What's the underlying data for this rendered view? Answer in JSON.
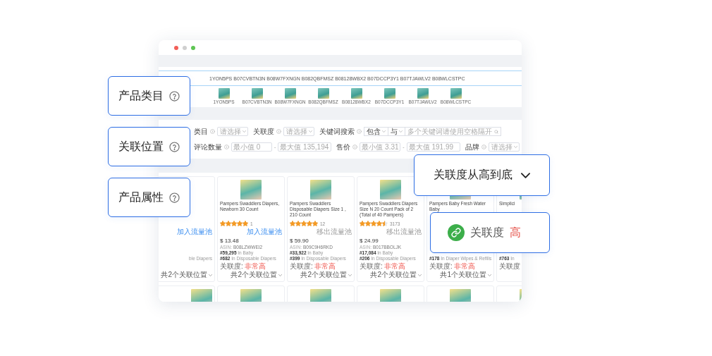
{
  "asin_list": "1YON5PS B07CVBTN3N B08W7FXNGN B082QBFMSZ B08128WBX2 B07DCCP3Y1 B07TJAWLV2 B08WLCSTPC",
  "thumbnails": [
    {
      "asin": "1YON5PS"
    },
    {
      "asin": "B07CVBTN3N"
    },
    {
      "asin": "B08W7FXNGN"
    },
    {
      "asin": "B082QBFMSZ"
    },
    {
      "asin": "B08128WBX2"
    },
    {
      "asin": "B07DCCP3Y1"
    },
    {
      "asin": "B07TJAWLV2"
    },
    {
      "asin": "B08WLCSTPC"
    }
  ],
  "filters": [
    [
      {
        "kind": "select",
        "label": "类目",
        "placeholder": "请选择"
      },
      {
        "kind": "select",
        "label": "关联度",
        "placeholder": "请选择"
      },
      {
        "kind": "keyword",
        "label": "关键词搜索",
        "mode": "包含",
        "logic": "与",
        "placeholder": "多个关键词请使用空格隔开"
      }
    ],
    [
      {
        "kind": "range",
        "label": "评论数量",
        "min_placeholder": "最小值 0",
        "separator": "-",
        "max_placeholder": "最大值 135,194"
      },
      {
        "kind": "range",
        "label": "售价",
        "min_placeholder": "最小值 3.31",
        "separator": "-",
        "max_placeholder": "最大值 191.99"
      },
      {
        "kind": "select",
        "label": "品牌",
        "placeholder": "请选择"
      }
    ]
  ],
  "cards": [
    {
      "kind": "partial",
      "action": "加入流量池",
      "action_added": false,
      "rank_category": "ble Diapers",
      "relations": "共2个关联位置"
    },
    {
      "kind": "full",
      "title": "Pampers Swaddlers Diapers, Newborn 30 Count",
      "stars": 5,
      "reviews": "1",
      "action": "加入流量池",
      "action_added": false,
      "price": "$ 13.48",
      "asin_label": "ASIN:",
      "asin": "B08LZWWEI2",
      "rank_main": "**#59,295** In Baby",
      "rank_category": "**#682** In Disposable Diapers",
      "relevance_label": "关联度:",
      "relevance": "非常高",
      "relations": "共2个关联位置"
    },
    {
      "kind": "full",
      "title": "Pampers Swaddlers Disposable Diapers Size 1 , 210 Count",
      "stars": 5,
      "reviews": "12",
      "action": "移出流量池",
      "action_added": true,
      "price": "$ 59.90",
      "asin_label": "ASIN:",
      "asin": "B09C9H6RKD",
      "rank_main": "**#33,922** In Baby",
      "rank_category": "**#399** In Disposable Diapers",
      "relevance_label": "关联度:",
      "relevance": "非常高",
      "relations": "共2个关联位置"
    },
    {
      "kind": "full",
      "title": "Pampers Swaddlers Diapers Size N 20 Count Pack of 2 (Total of 40 Pampers)",
      "stars": 4.5,
      "reviews": "3173",
      "action": "移出流量池",
      "action_added": true,
      "price": "$ 24.99",
      "asin_label": "ASIN:",
      "asin": "B017BBOLJK",
      "rank_main": "**#17,084** In Baby",
      "rank_category": "**#206** In Disposable Diapers",
      "relevance_label": "关联度:",
      "relevance": "非常高",
      "relations": "共2个关联位置"
    },
    {
      "kind": "full",
      "title": "Pampers Baby Fresh Water Baby",
      "rank_category": "**#178** In Diaper Wipes & Refills",
      "relevance_label": "关联度:",
      "relevance": "非常高",
      "relations": "共1个关联位置"
    },
    {
      "kind": "full",
      "title": "Simplici",
      "rank_category": "**#763** In",
      "relevance_label": "关联度"
    }
  ],
  "callouts": [
    {
      "kind": "help",
      "label": "产品类目"
    },
    {
      "kind": "help",
      "label": "关联位置"
    },
    {
      "kind": "help",
      "label": "产品属性"
    },
    {
      "kind": "sort",
      "label": "关联度从高到底"
    },
    {
      "kind": "relevance",
      "label": "关联度",
      "value": "高"
    }
  ]
}
